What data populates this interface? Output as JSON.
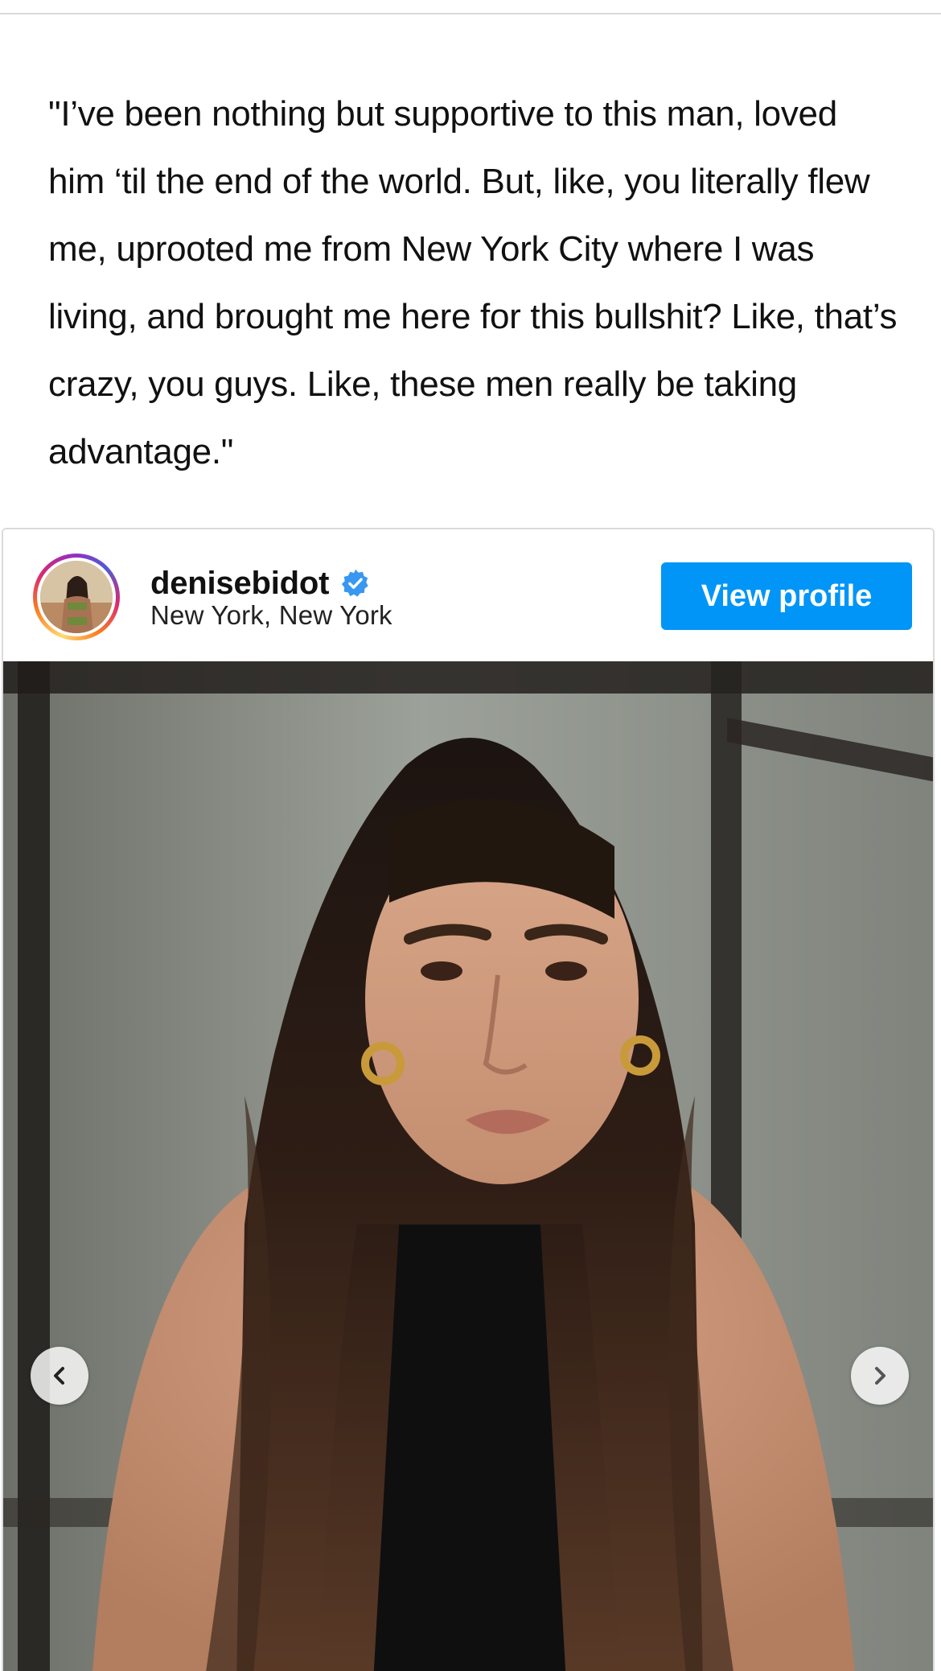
{
  "article": {
    "quote": "\"I’ve been nothing but supportive to this man, loved him ‘til the end of the world. But, like, you literally flew me, uprooted me from New York City where I was living, and brought me here for this bullshit? Like, that’s crazy, you guys. Like, these men really be taking advantage.\""
  },
  "instagram_embed": {
    "username": "denisebidot",
    "verified": true,
    "location": "New York, New York",
    "view_profile_label": "View profile",
    "avatar_icon": "profile-photo",
    "verified_icon": "verified-badge-icon",
    "prev_icon": "chevron-left-icon",
    "next_icon": "chevron-right-icon"
  },
  "colors": {
    "button_blue": "#0095f6",
    "verified_blue": "#3897f0",
    "text": "#111111",
    "border": "#dbdbdb"
  }
}
